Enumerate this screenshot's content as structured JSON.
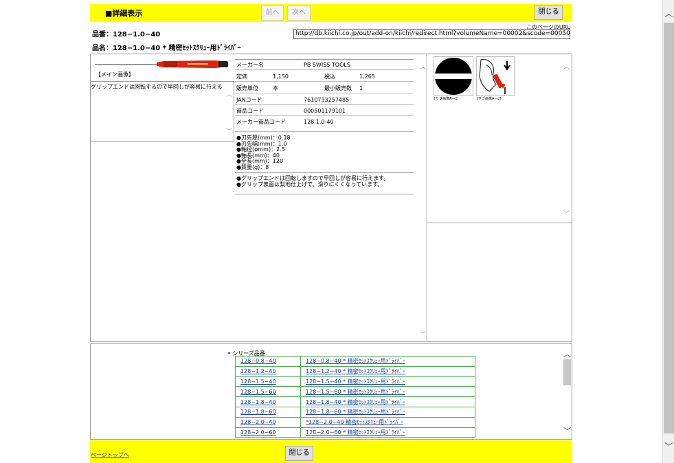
{
  "header": {
    "title": "■詳細表示",
    "prev_label": "前へ",
    "next_label": "次へ",
    "close_label": "閉じる"
  },
  "product": {
    "part_no_label": "品番：",
    "part_no": "128−1.0−40",
    "name_label": "品名：",
    "name": "128−1.0−40 * 精密ｾｯﾄｽｸﾘｭｰ用ﾄﾞﾗｲﾊﾞｰ"
  },
  "url": {
    "caption": "このページのURL",
    "value": "http://db.kiichi.co.jp/out/add-on/kiichi/redirect.html?volumeName=00002&scode=000501179101"
  },
  "main_image": {
    "caption": "【メイン画像】",
    "description": "グリップエンドは回転するので早回しが容易に行える"
  },
  "specs": {
    "maker_label": "メーカー名",
    "maker": "PB SWISS TOOLS",
    "list_price_label": "定価",
    "list_price": "1,150",
    "tax_incl_label": "税込",
    "tax_incl": "1,265",
    "unit_label": "販売単位",
    "unit": "本",
    "min_qty_label": "最小販売数",
    "min_qty": "1",
    "jan_label": "JANコード",
    "jan": "7610733257485",
    "code_label": "商品コード",
    "code": "000501179101",
    "maker_code_label": "メーカー商品コード",
    "maker_code": "128.1.0-40"
  },
  "features1": [
    "●刃先厚(mm)：0.18",
    "●刃先幅(mm)：1.0",
    "●軸径(φmm)：2.5",
    "●軸長(mm)：40",
    "●全長(mm)：120",
    "●質量(g)：8"
  ],
  "features2": [
    "●グリップエンドは回転しますので早回しが容易に行えます。",
    "●グリップ表面は梨地仕上げで、滑りにくくなっています。"
  ],
  "sub_images": [
    "[サブ画像A―1]",
    "[サブ画像A―2]"
  ],
  "series": {
    "title": "シリーズ品番",
    "rows": [
      {
        "code": "128−0.8−40",
        "name": "128−0.8−40 * 精密ｾｯﾄｽｸﾘｭｰ用ﾄﾞﾗｲﾊﾞｰ"
      },
      {
        "code": "128−1.2−40",
        "name": "128−1.2−40 * 精密ｾｯﾄｽｸﾘｭｰ用ﾄﾞﾗｲﾊﾞｰ"
      },
      {
        "code": "128−1.5−40",
        "name": "128−1.5−40 * 精密ｾｯﾄｽｸﾘｭｰ用ﾄﾞﾗｲﾊﾞｰ"
      },
      {
        "code": "128−1.5−60",
        "name": "128−1.5−60 * 精密ｾｯﾄｽｸﾘｭｰ用ﾄﾞﾗｲﾊﾞｰ"
      },
      {
        "code": "128−1.8−40",
        "name": "128−1.8−40 * 精密ｾｯﾄｽｸﾘｭｰ用ﾄﾞﾗｲﾊﾞｰ"
      },
      {
        "code": "128−1.8−60",
        "name": "128−1.8−60 * 精密ｾｯﾄｽｸﾘｭｰ用ﾄﾞﾗｲﾊﾞｰ"
      },
      {
        "code": "128−2.0−40",
        "name": "*128−2.0−40 精密ｾｯﾄｽｸﾘｭｰ用ﾄﾞﾗｲﾊﾞｰ"
      },
      {
        "code": "128−2.0−60",
        "name": "128−2.0−60 * 精密ｾｯﾄｽｸﾘｭｰ用ﾄﾞﾗｲﾊﾞｰ"
      }
    ]
  },
  "footer": {
    "page_top_label": "ページトップへ",
    "close_label": "閉じる"
  },
  "colors": {
    "bar": "#ffff00",
    "link": "#1a3fae",
    "series_border": "#4caf50"
  }
}
